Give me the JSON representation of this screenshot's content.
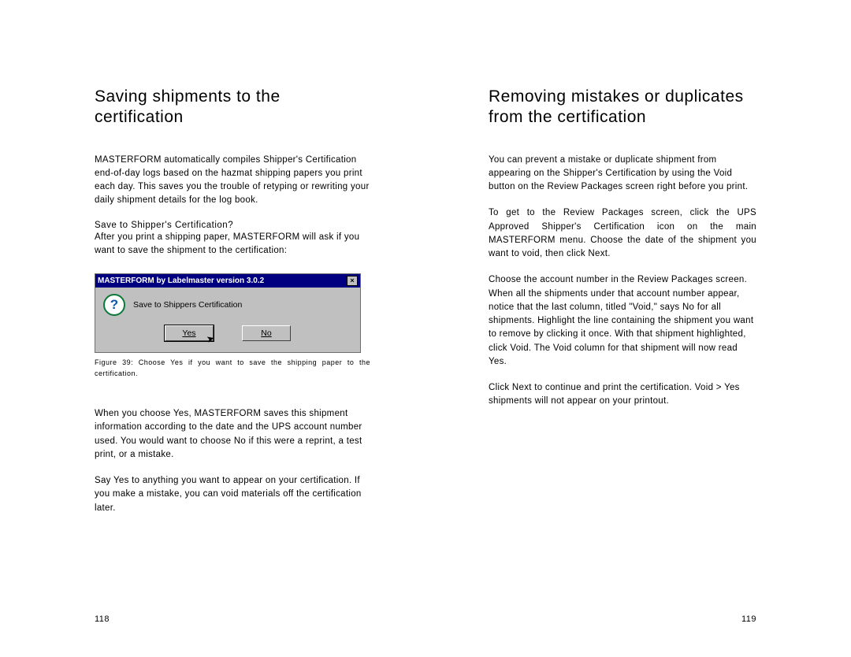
{
  "left": {
    "heading": "Saving shipments to the certification",
    "para1": "MASTERFORM automatically compiles Shipper's Certification end-of-day logs based on the hazmat shipping papers you print each day. This saves you the trouble of retyping or rewriting your daily shipment details for the log book.",
    "subhead": "Save to Shipper's Certification?",
    "para2": "After you print a shipping paper, MASTERFORM will ask if you want to save the shipment to the certification:",
    "dialog": {
      "title": "MASTERFORM by Labelmaster version 3.0.2",
      "close_glyph": "×",
      "icon_label": "?",
      "message": "Save to Shippers Certification",
      "yes": "Yes",
      "no": "No"
    },
    "caption": "Figure 39: Choose Yes if you want to save the shipping paper to the certification.",
    "para3": "When you choose Yes, MASTERFORM saves this shipment information according to the date and the UPS account number used. You would want to choose No if this were a reprint, a test print, or a mistake.",
    "para4": "Say Yes to anything you want to appear on your certification. If you make a mistake, you can void materials off the certification later.",
    "page_number": "118"
  },
  "right": {
    "heading": "Removing mistakes or duplicates from the certification",
    "para1": "You can prevent a mistake or duplicate shipment from appearing on the Shipper's Certification by using the Void button on the Review Packages screen right before you print.",
    "para2": "To get to the Review Packages screen, click the UPS Approved Shipper's Certification icon on the main MASTERFORM menu. Choose the date of the shipment you want to void, then click Next.",
    "para3": "Choose the account number in the Review Packages screen. When all the shipments under that account number appear, notice that the last column, titled \"Void,\" says No for all shipments. Highlight the line containing the shipment you want to remove by clicking it once. With that shipment highlighted, click Void. The Void column for that shipment will now read Yes.",
    "para4": "Click Next to continue and print the certification. Void > Yes shipments will not appear on your printout.",
    "page_number": "119"
  }
}
